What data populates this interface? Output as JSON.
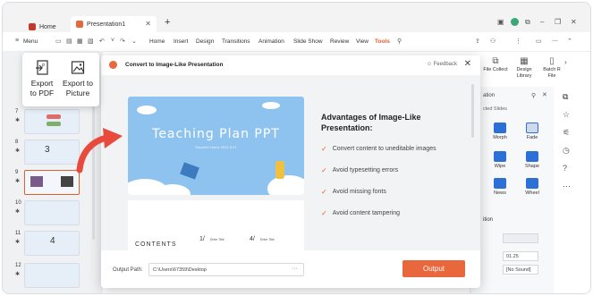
{
  "tabs": [
    {
      "label": "Home"
    },
    {
      "label": "Presentation1"
    }
  ],
  "menu": {
    "menu_label": "Menu",
    "items": [
      "Home",
      "Insert",
      "Design",
      "Transitions",
      "Animation",
      "Slide Show",
      "Review",
      "View",
      "Tools"
    ],
    "active": "Tools"
  },
  "export_popup": {
    "pdf_label_1": "Export",
    "pdf_label_2": "to PDF",
    "pic_label_1": "Export to",
    "pic_label_2": "Picture"
  },
  "slides": {
    "numbers": [
      "7",
      "8",
      "9",
      "10",
      "11",
      "12"
    ],
    "thumb_texts": {
      "s8": "3",
      "s11": "4"
    }
  },
  "ribbon_right": {
    "file_collect": "File Collect",
    "design_library_1": "Design",
    "design_library_2": "Library",
    "batch_1": "Batch R",
    "batch_2": "File"
  },
  "side_panel": {
    "title": "ation",
    "subtitle": "cted Slides",
    "animations": [
      "Morph",
      "Fade",
      "Wipe",
      "Shape",
      "News",
      "Wheel"
    ],
    "section": "ition",
    "duration": "01.25",
    "sound": "[No Sound]"
  },
  "modal": {
    "title": "Convert to Image-Like Presentation",
    "feedback": "Feedback",
    "adv_title": "Advantages of Image-Like Presentation:",
    "advantages": [
      "Convert content to uneditable images",
      "Avoid typesetting errors",
      "Avoid missing fonts",
      "Avoid content tampering"
    ],
    "path_label": "Output Path:",
    "path_value": "C:\\Users\\67359\\Desktop",
    "path_more": "···",
    "output_label": "Output"
  },
  "preview": {
    "slide_title": "Teaching Plan PPT",
    "slide_subtitle": "Reporter Name    2021.8.21",
    "slide2_left": "CONTENTS",
    "slide2_num1": "1/",
    "slide2_item1": "Enter Title",
    "slide2_num2": "4/",
    "slide2_item2": "Enter Title"
  },
  "colors": {
    "accent": "#e8673c",
    "slide_bg": "#8fc3ef"
  }
}
